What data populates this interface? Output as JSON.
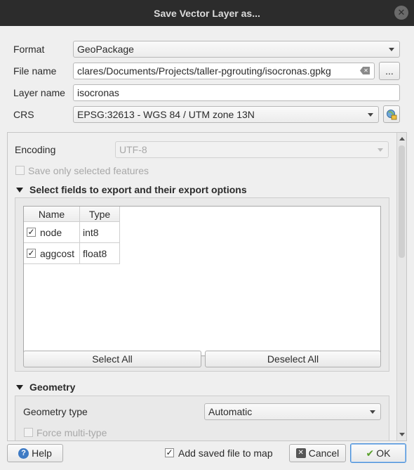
{
  "window": {
    "title": "Save Vector Layer as..."
  },
  "form": {
    "format_label": "Format",
    "format_value": "GeoPackage",
    "filename_label": "File name",
    "filename_value": "clares/Documents/Projects/taller-pgrouting/isocronas.gpkg",
    "browse_label": "...",
    "layername_label": "Layer name",
    "layername_value": "isocronas",
    "crs_label": "CRS",
    "crs_value": "EPSG:32613 - WGS 84 / UTM zone 13N"
  },
  "panel": {
    "encoding_label": "Encoding",
    "encoding_value": "UTF-8",
    "save_selected_label": "Save only selected features",
    "fields_section_title": "Select fields to export and their export options",
    "table": {
      "headers": [
        "Name",
        "Type"
      ],
      "rows": [
        {
          "name": "node",
          "type": "int8",
          "checked": true
        },
        {
          "name": "aggcost",
          "type": "float8",
          "checked": true
        }
      ]
    },
    "select_all_label": "Select All",
    "deselect_all_label": "Deselect All",
    "geometry_section_title": "Geometry",
    "geometry_type_label": "Geometry type",
    "geometry_type_value": "Automatic",
    "force_multi_label": "Force multi-type"
  },
  "footer": {
    "help_label": "Help",
    "add_saved_label": "Add saved file to map",
    "add_saved_checked": true,
    "cancel_label": "Cancel",
    "ok_label": "OK"
  }
}
